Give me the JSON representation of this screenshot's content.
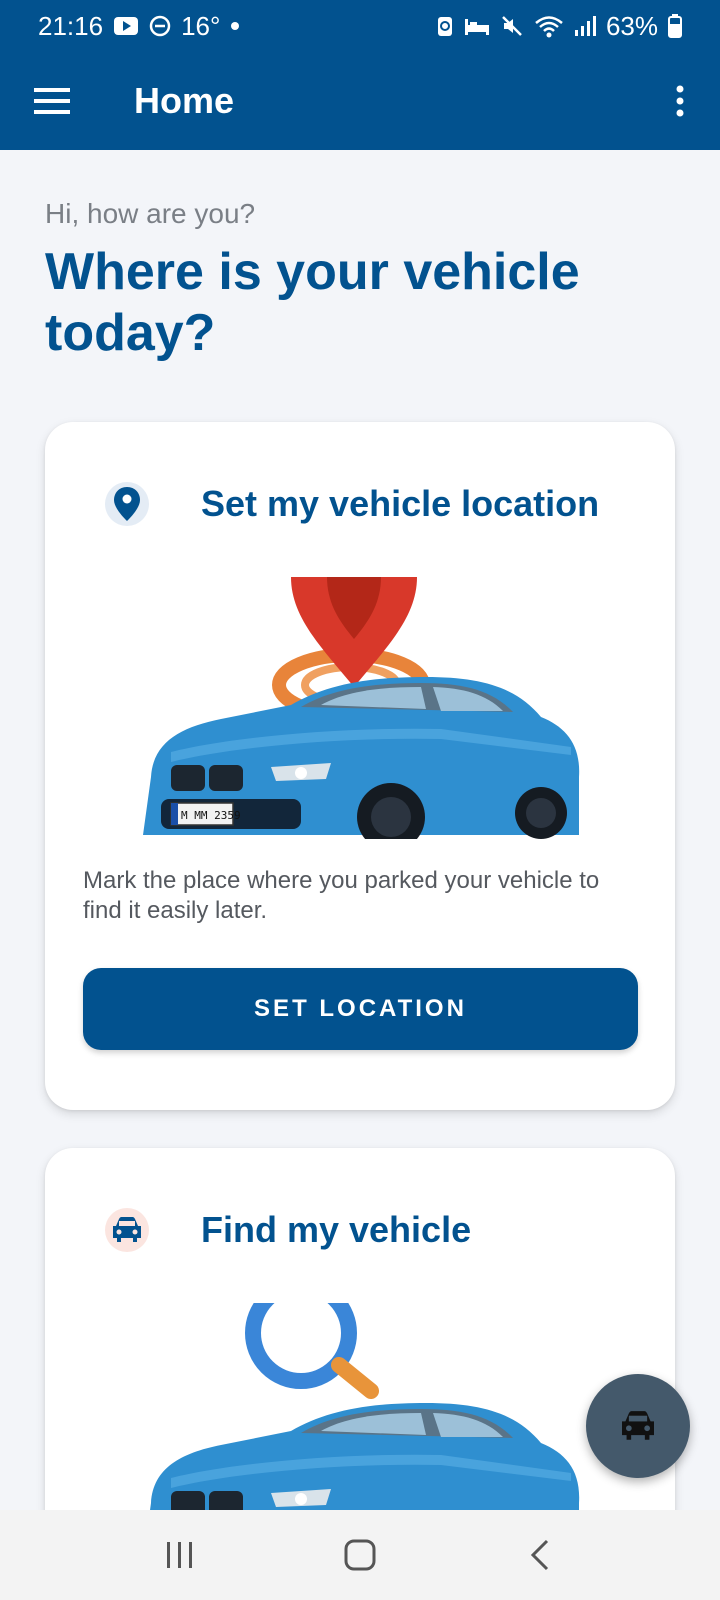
{
  "status_bar": {
    "time": "21:16",
    "temperature": "16°",
    "battery": "63%",
    "icons": [
      "youtube-icon",
      "dnd-icon",
      "dot-icon",
      "sync-icon",
      "sleep-icon",
      "mute-icon",
      "wifi-icon",
      "signal-icon",
      "battery-icon"
    ]
  },
  "app_bar": {
    "title": "Home",
    "menu_icon": "hamburger-menu-icon",
    "more_icon": "more-vertical-icon"
  },
  "header": {
    "greeting": "Hi, how are you?",
    "headline": "Where is your vehicle today?"
  },
  "cards": [
    {
      "icon": "location-pin-icon",
      "title": "Set my vehicle location",
      "description": "Mark the place where you parked your vehicle to find it easily later.",
      "button_label": "SET LOCATION",
      "plate": "M MM 2359"
    },
    {
      "icon": "car-icon",
      "title": "Find my vehicle"
    }
  ],
  "fab": {
    "icon": "car-icon"
  },
  "nav_bar": {
    "icons": [
      "recents-icon",
      "home-icon",
      "back-icon"
    ]
  },
  "colors": {
    "primary": "#02528f",
    "background": "#f3f5f9",
    "fab": "#44596b",
    "pin_red": "#d8382a",
    "car_blue": "#2f8fd0"
  }
}
